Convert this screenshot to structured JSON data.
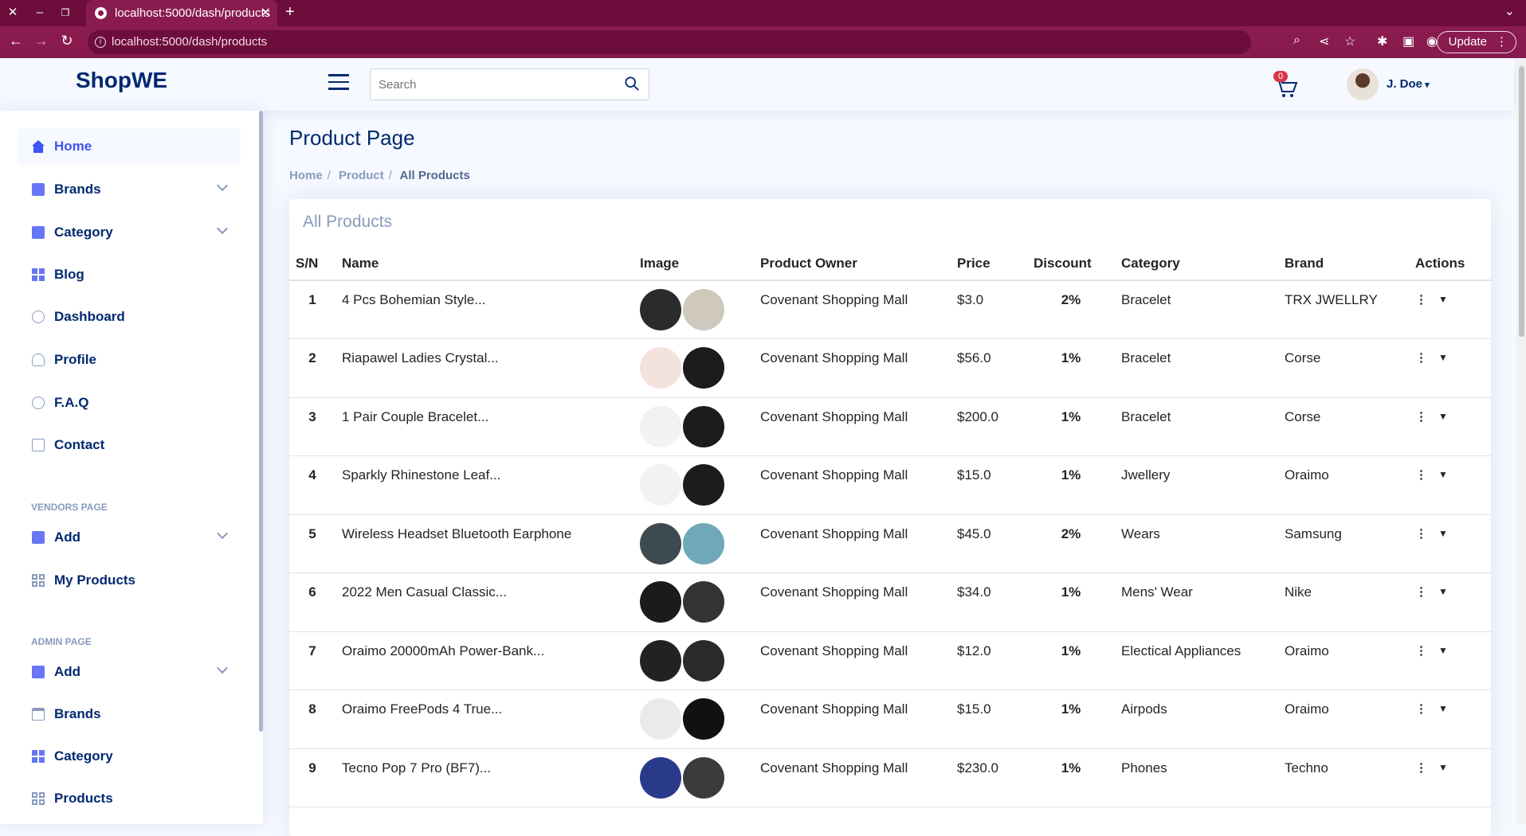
{
  "browser": {
    "tab_title": "localhost:5000/dash/products",
    "url": "localhost:5000/dash/products",
    "update_label": "Update"
  },
  "header": {
    "logo": "ShopWE",
    "search_placeholder": "Search",
    "cart_count": "0",
    "user_name": "J. Doe"
  },
  "sidebar": {
    "items": [
      {
        "label": "Home"
      },
      {
        "label": "Brands"
      },
      {
        "label": "Category"
      },
      {
        "label": "Blog"
      },
      {
        "label": "Dashboard"
      },
      {
        "label": "Profile"
      },
      {
        "label": "F.A.Q"
      },
      {
        "label": "Contact"
      }
    ],
    "vendors_heading": "VENDORS PAGE",
    "vendor_items": [
      {
        "label": "Add"
      },
      {
        "label": "My Products"
      }
    ],
    "admin_heading": "ADMIN PAGE",
    "admin_items": [
      {
        "label": "Add"
      },
      {
        "label": "Brands"
      },
      {
        "label": "Category"
      },
      {
        "label": "Products"
      }
    ]
  },
  "main": {
    "page_title": "Product Page",
    "breadcrumb": [
      "Home",
      "Product",
      "All Products"
    ],
    "card_title": "All Products",
    "columns": [
      "S/N",
      "Name",
      "Image",
      "Product Owner",
      "Price",
      "Discount",
      "Category",
      "Brand",
      "Actions"
    ],
    "rows": [
      {
        "sn": "1",
        "name": "4 Pcs Bohemian Style...",
        "owner": "Covenant Shopping Mall",
        "price": "$3.0",
        "discount": "2%",
        "category": "Bracelet",
        "brand": "TRX JWELLRY"
      },
      {
        "sn": "2",
        "name": "Riapawel Ladies Crystal...",
        "owner": "Covenant Shopping Mall",
        "price": "$56.0",
        "discount": "1%",
        "category": "Bracelet",
        "brand": "Corse"
      },
      {
        "sn": "3",
        "name": "1 Pair Couple Bracelet...",
        "owner": "Covenant Shopping Mall",
        "price": "$200.0",
        "discount": "1%",
        "category": "Bracelet",
        "brand": "Corse"
      },
      {
        "sn": "4",
        "name": "Sparkly Rhinestone Leaf...",
        "owner": "Covenant Shopping Mall",
        "price": "$15.0",
        "discount": "1%",
        "category": "Jwellery",
        "brand": "Oraimo"
      },
      {
        "sn": "5",
        "name": "Wireless Headset Bluetooth Earphone",
        "owner": "Covenant Shopping Mall",
        "price": "$45.0",
        "discount": "2%",
        "category": "Wears",
        "brand": "Samsung"
      },
      {
        "sn": "6",
        "name": "2022 Men Casual Classic...",
        "owner": "Covenant Shopping Mall",
        "price": "$34.0",
        "discount": "1%",
        "category": "Mens' Wear",
        "brand": "Nike"
      },
      {
        "sn": "7",
        "name": "Oraimo 20000mAh Power-Bank...",
        "owner": "Covenant Shopping Mall",
        "price": "$12.0",
        "discount": "1%",
        "category": "Electical Appliances",
        "brand": "Oraimo"
      },
      {
        "sn": "8",
        "name": "Oraimo FreePods 4 True...",
        "owner": "Covenant Shopping Mall",
        "price": "$15.0",
        "discount": "1%",
        "category": "Airpods",
        "brand": "Oraimo"
      },
      {
        "sn": "9",
        "name": "Tecno Pop 7 Pro (BF7)...",
        "owner": "Covenant Shopping Mall",
        "price": "$230.0",
        "discount": "1%",
        "category": "Phones",
        "brand": "Techno"
      }
    ]
  },
  "colors": {
    "primary": "#012970",
    "accent": "#4154f1",
    "browser": "#8a1b4f",
    "badge": "#dc3545"
  }
}
